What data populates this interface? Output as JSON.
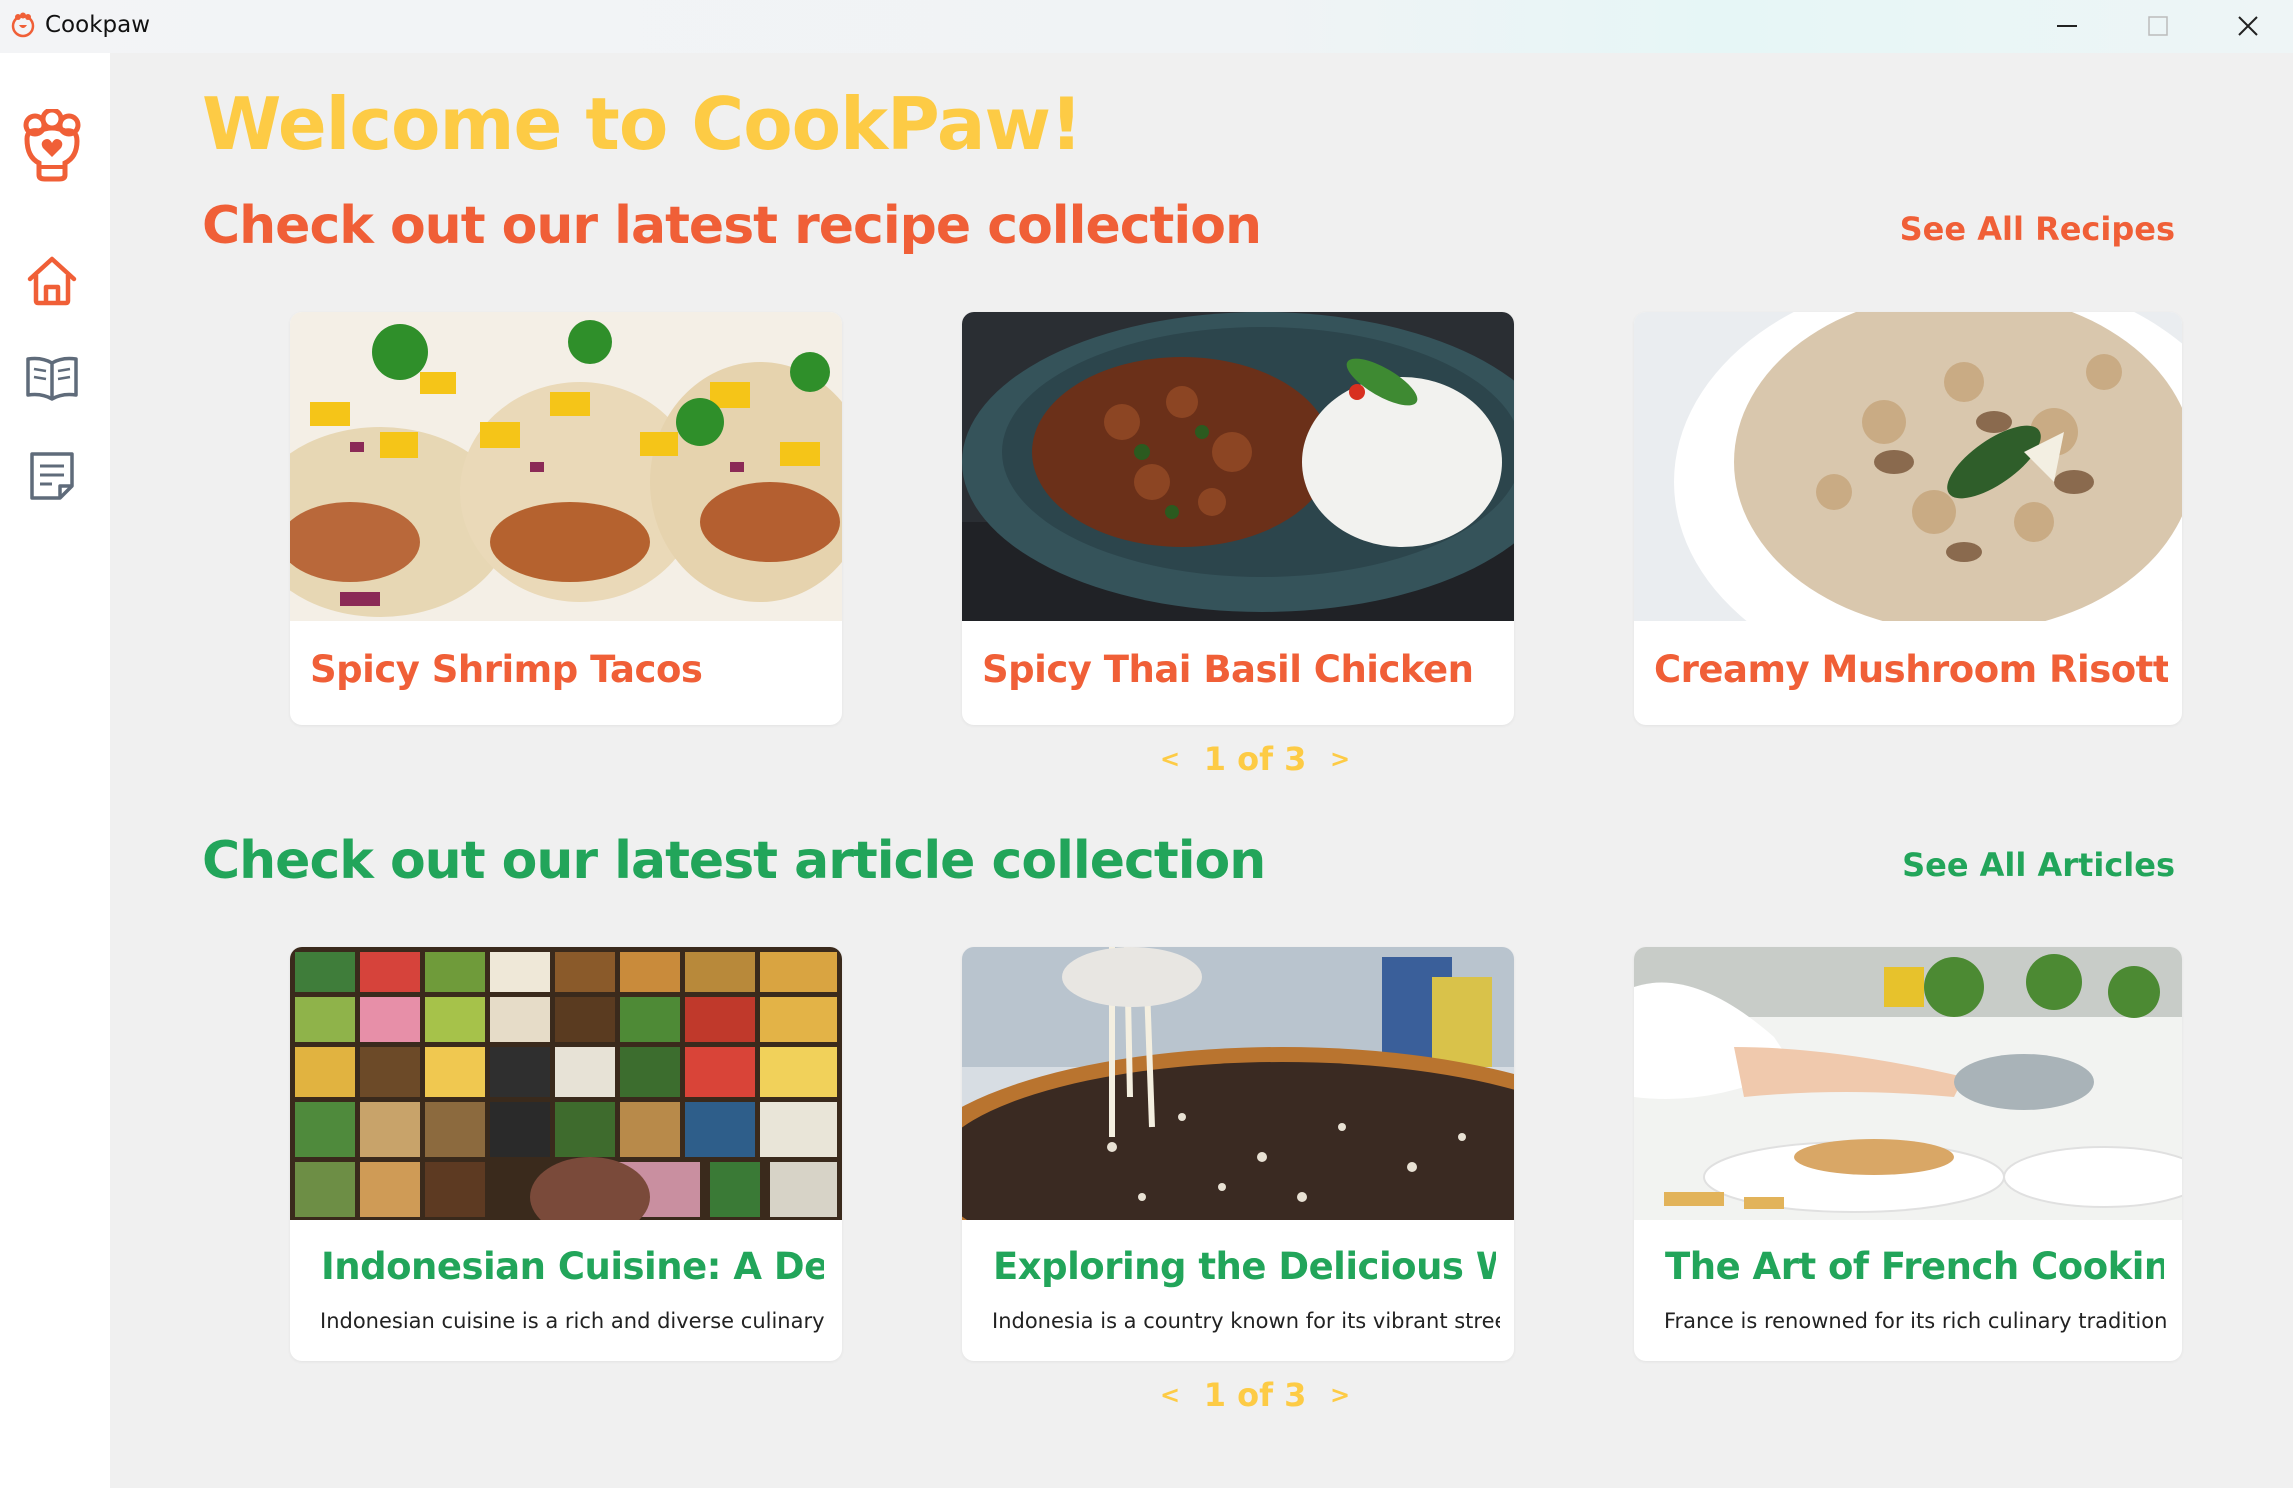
{
  "window": {
    "title": "Cookpaw",
    "controls": [
      "minimize-icon",
      "maximize-icon",
      "close-icon"
    ]
  },
  "sidebar": {
    "logo_icon": "paw-heart-logo-icon",
    "items": [
      {
        "icon": "home-icon",
        "active": true
      },
      {
        "icon": "open-book-icon",
        "active": false
      },
      {
        "icon": "article-icon",
        "active": false
      }
    ]
  },
  "main": {
    "welcome": "Welcome to CookPaw!",
    "recipes": {
      "heading": "Check out our latest recipe collection",
      "see_all": "See All Recipes",
      "cards": [
        {
          "name": "Spicy Shrimp Tacos"
        },
        {
          "name": "Spicy Thai Basil Chicken"
        },
        {
          "name": "Creamy Mushroom Risotto"
        }
      ],
      "pager": {
        "prev": "<",
        "label": "1 of 3",
        "next": ">"
      }
    },
    "articles": {
      "heading": "Check out our latest article collection",
      "see_all": "See All Articles",
      "cards": [
        {
          "title": "Indonesian Cuisine: A Deli",
          "excerpt": "Indonesian cuisine is a rich and diverse culinary"
        },
        {
          "title": "Exploring the Delicious Wo",
          "excerpt": "Indonesia is a country known for its vibrant stree"
        },
        {
          "title": "The Art of French Cooking",
          "excerpt": "France is renowned for its rich culinary tradition.."
        }
      ],
      "pager": {
        "prev": "<",
        "label": "1 of 3",
        "next": ">"
      }
    }
  },
  "colors": {
    "accent_yellow": "#fdcb45",
    "recipe_orange": "#f05f37",
    "article_green": "#22a55a",
    "background": "#f0f0f0"
  }
}
